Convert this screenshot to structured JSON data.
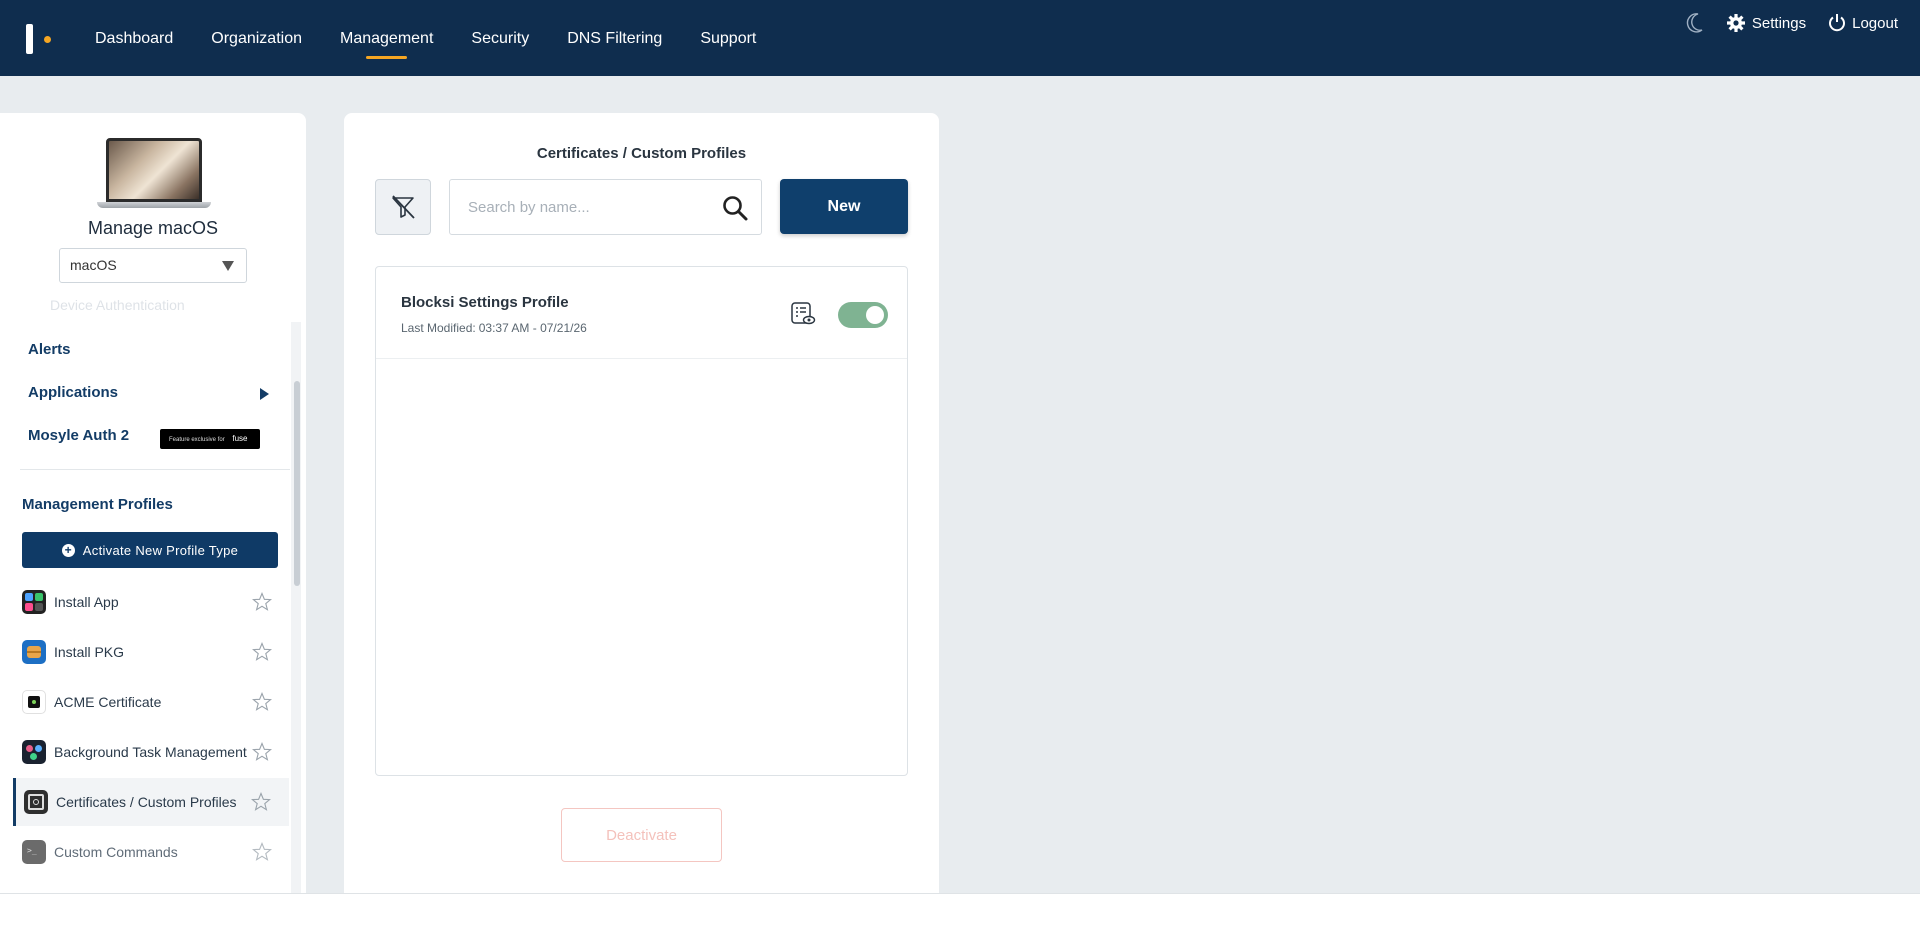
{
  "nav": {
    "items": [
      {
        "label": "Dashboard",
        "name": "nav-dashboard"
      },
      {
        "label": "Organization",
        "name": "nav-organization"
      },
      {
        "label": "Management",
        "name": "nav-management"
      },
      {
        "label": "Security",
        "name": "nav-security"
      },
      {
        "label": "DNS Filtering",
        "name": "nav-dns-filtering"
      },
      {
        "label": "Support",
        "name": "nav-support"
      }
    ],
    "active": "Management",
    "settings_label": "Settings",
    "logout_label": "Logout",
    "accent_color": "#f5a623",
    "bar_color": "#0f2d4e"
  },
  "sidebar": {
    "title": "Manage macOS",
    "os_value": "macOS",
    "faded_item": "Device Authentication",
    "items": [
      {
        "label": "Alerts"
      },
      {
        "label": "Applications"
      },
      {
        "label": "Mosyle Auth 2"
      }
    ],
    "badge_text": "Feature exclusive for",
    "badge_brand": "fuse",
    "section_title": "Management Profiles",
    "activate_label": "Activate New Profile Type",
    "profiles": [
      {
        "label": "Install App",
        "icon": "install-app-icon"
      },
      {
        "label": "Install PKG",
        "icon": "install-pkg-icon"
      },
      {
        "label": "ACME Certificate",
        "icon": "acme-certificate-icon"
      },
      {
        "label": "Background Task Management",
        "icon": "background-task-icon"
      },
      {
        "label": "Certificates / Custom Profiles",
        "icon": "certificate-icon"
      },
      {
        "label": "Custom Commands",
        "icon": "terminal-icon"
      }
    ]
  },
  "main": {
    "title": "Certificates / Custom Profiles",
    "search_placeholder": "Search by name...",
    "new_label": "New",
    "list": [
      {
        "title": "Blocksi Settings Profile",
        "modified_label": "Last Modified:",
        "modified_value": "03:37 AM - 07/21/26",
        "enabled": true
      }
    ],
    "deactivate_label": "Deactivate",
    "toggle_color": "#7fb392"
  }
}
